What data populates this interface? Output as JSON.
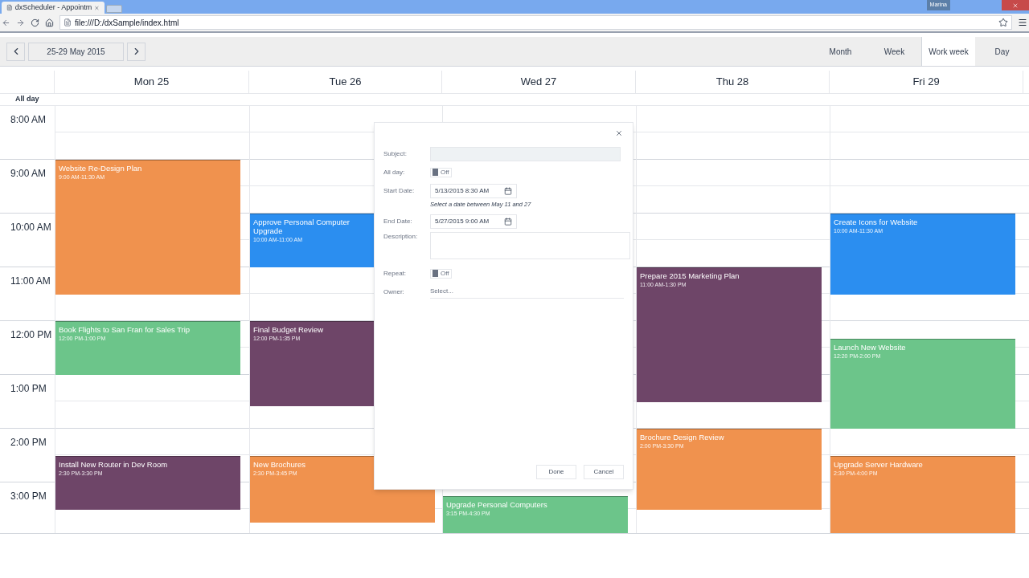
{
  "browser": {
    "tab_title": "dxScheduler - Appointm",
    "user": "Marina",
    "url": "file:///D:/dxSample/index.html"
  },
  "toolbar": {
    "date_range": "25-29 May 2015",
    "views": [
      {
        "label": "Month",
        "selected": false
      },
      {
        "label": "Week",
        "selected": false
      },
      {
        "label": "Work week",
        "selected": true
      },
      {
        "label": "Day",
        "selected": false
      }
    ]
  },
  "days": [
    {
      "label": "Mon 25",
      "appointments": [
        {
          "title": "Website Re-Design Plan",
          "time": "9:00 AM-11:30 AM",
          "color": "#f0924e"
        },
        {
          "title": "Book Flights to San Fran for Sales Trip",
          "time": "12:00 PM-1:00 PM",
          "color": "#6cc58a"
        },
        {
          "title": "Install New Router in Dev Room",
          "time": "2:30 PM-3:30 PM",
          "color": "#6e4568"
        }
      ]
    },
    {
      "label": "Tue 26",
      "appointments": [
        {
          "title": "Approve Personal Computer Upgrade",
          "time": "10:00 AM-11:00 AM",
          "color": "#2b8ef0"
        },
        {
          "title": "Final Budget Review",
          "time": "12:00 PM-1:35 PM",
          "color": "#6e4568"
        },
        {
          "title": "New Brochures",
          "time": "2:30 PM-3:45 PM",
          "color": "#f0924e"
        }
      ]
    },
    {
      "label": "Wed 27",
      "appointments": [
        {
          "title": "Upgrade Personal Computers",
          "time": "3:15 PM-4:30 PM",
          "color": "#6cc58a"
        }
      ]
    },
    {
      "label": "Thu 28",
      "appointments": [
        {
          "title": "Prepare 2015 Marketing Plan",
          "time": "11:00 AM-1:30 PM",
          "color": "#6e4568"
        },
        {
          "title": "Brochure Design Review",
          "time": "2:00 PM-3:30 PM",
          "color": "#f0924e"
        }
      ]
    },
    {
      "label": "Fri 29",
      "appointments": [
        {
          "title": "Create Icons for Website",
          "time": "10:00 AM-11:30 AM",
          "color": "#2b8ef0"
        },
        {
          "title": "Launch New Website",
          "time": "12:20 PM-2:00 PM",
          "color": "#6cc58a"
        },
        {
          "title": "Upgrade Server Hardware",
          "time": "2:30 PM-4:00 PM",
          "color": "#f0924e"
        }
      ]
    }
  ],
  "all_day_label": "All day",
  "hours": [
    "8:00 AM",
    "9:00 AM",
    "10:00 AM",
    "11:00 AM",
    "12:00 PM",
    "1:00 PM",
    "2:00 PM",
    "3:00 PM"
  ],
  "dialog": {
    "fields": [
      {
        "kind": "text",
        "label": "Subject:"
      },
      {
        "kind": "switch",
        "label": "All day:",
        "on": false,
        "text": "Off"
      },
      {
        "kind": "date",
        "label": "Start Date:",
        "value": "5/13/2015 8:30 AM",
        "hint": "Select a date between May 11 and 27"
      },
      {
        "kind": "date",
        "label": "End Date:",
        "value": "5/27/2015 9:00 AM"
      },
      {
        "kind": "textarea",
        "label": "Description:"
      },
      {
        "kind": "switch",
        "label": "Repeat:",
        "on": false,
        "text": "Off"
      },
      {
        "kind": "select",
        "label": "Owner:",
        "placeholder": "Select..."
      }
    ],
    "buttons": [
      "Done",
      "Cancel"
    ]
  }
}
